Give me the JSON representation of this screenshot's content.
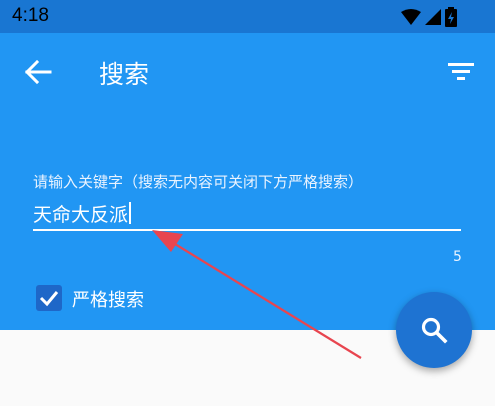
{
  "status_bar": {
    "time": "4:18",
    "icons": [
      "wifi-icon",
      "signal-icon",
      "battery-icon"
    ]
  },
  "app_bar": {
    "title": "搜索",
    "back_icon": "arrow-left-icon",
    "filter_icon": "filter-list-icon",
    "background_color": "#2196f3"
  },
  "search_field": {
    "label": "请输入关键字（搜索无内容可关闭下方严格搜索）",
    "value": "天命大反派",
    "counter": "5"
  },
  "strict_search": {
    "label": "严格搜索",
    "checked": true
  },
  "fab": {
    "icon": "search-icon",
    "color": "#1e73d2"
  },
  "annotation": {
    "arrow_color": "#e8454f"
  }
}
